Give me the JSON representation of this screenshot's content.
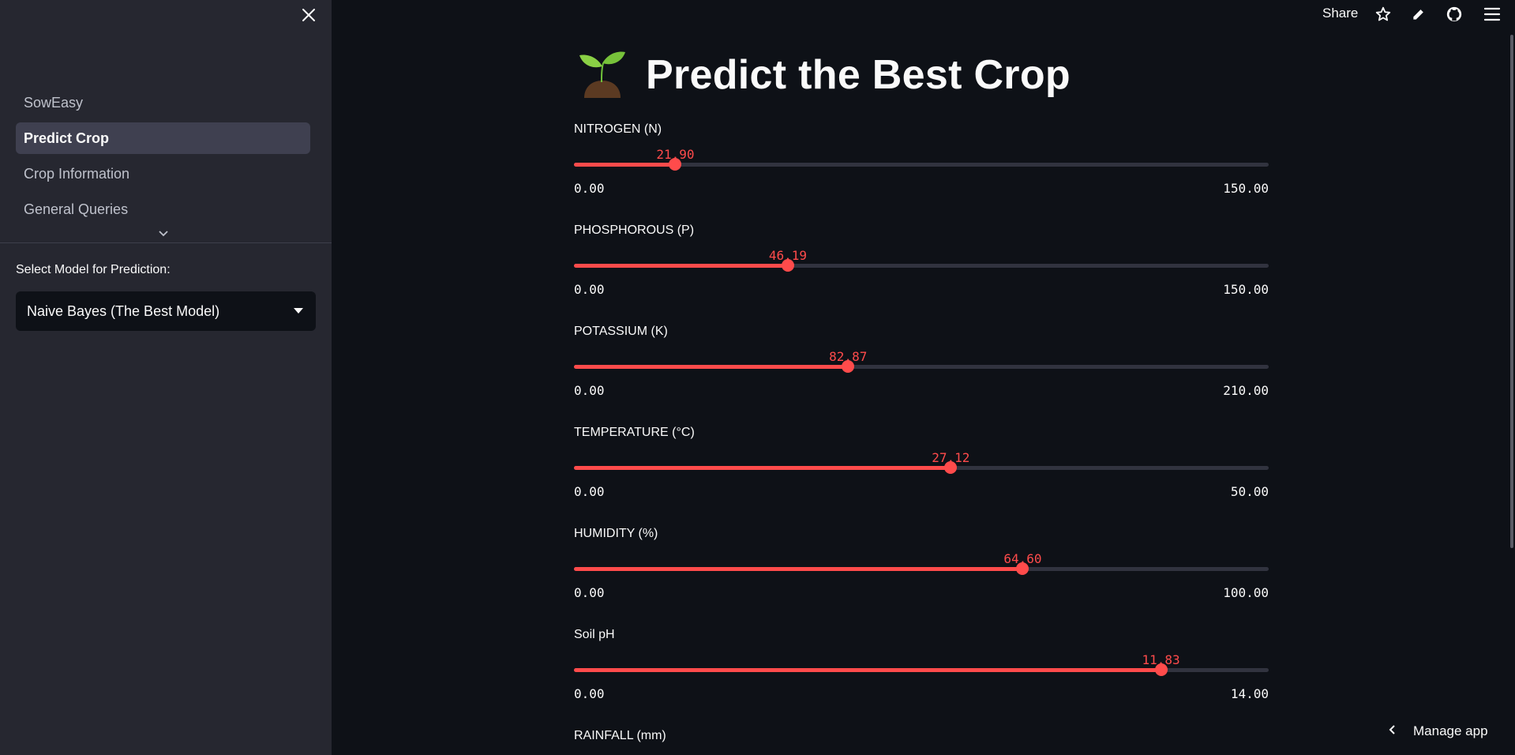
{
  "sidebar": {
    "close_icon": "close-icon",
    "nav_items": [
      {
        "label": "SowEasy",
        "active": false
      },
      {
        "label": "Predict Crop",
        "active": true
      },
      {
        "label": "Crop Information",
        "active": false
      },
      {
        "label": "General Queries",
        "active": false
      }
    ],
    "expand_icon": "chevron-down-icon",
    "model_label": "Select Model for Prediction:",
    "model_selected": "Naive Bayes (The Best Model)"
  },
  "topbar": {
    "share_label": "Share",
    "icons": [
      "star-icon",
      "edit-icon",
      "github-icon",
      "menu-icon"
    ]
  },
  "main": {
    "title": "Predict the Best Crop",
    "title_icon": "seedling-emoji",
    "sliders": [
      {
        "label": "NITROGEN (N)",
        "value": "21.90",
        "min": "0.00",
        "max": "150.00"
      },
      {
        "label": "PHOSPHOROUS (P)",
        "value": "46.19",
        "min": "0.00",
        "max": "150.00"
      },
      {
        "label": "POTASSIUM (K)",
        "value": "82.87",
        "min": "0.00",
        "max": "210.00"
      },
      {
        "label": "TEMPERATURE (°C)",
        "value": "27.12",
        "min": "0.00",
        "max": "50.00"
      },
      {
        "label": "HUMIDITY (%)",
        "value": "64.60",
        "min": "0.00",
        "max": "100.00"
      },
      {
        "label": "Soil pH",
        "value": "11.83",
        "min": "0.00",
        "max": "14.00"
      }
    ],
    "next_label": "RAINFALL (mm)"
  },
  "footer": {
    "manage_label": "Manage app"
  },
  "colors": {
    "accent": "#ff4b4b",
    "background": "#0e1117",
    "sidebar": "#262730"
  }
}
